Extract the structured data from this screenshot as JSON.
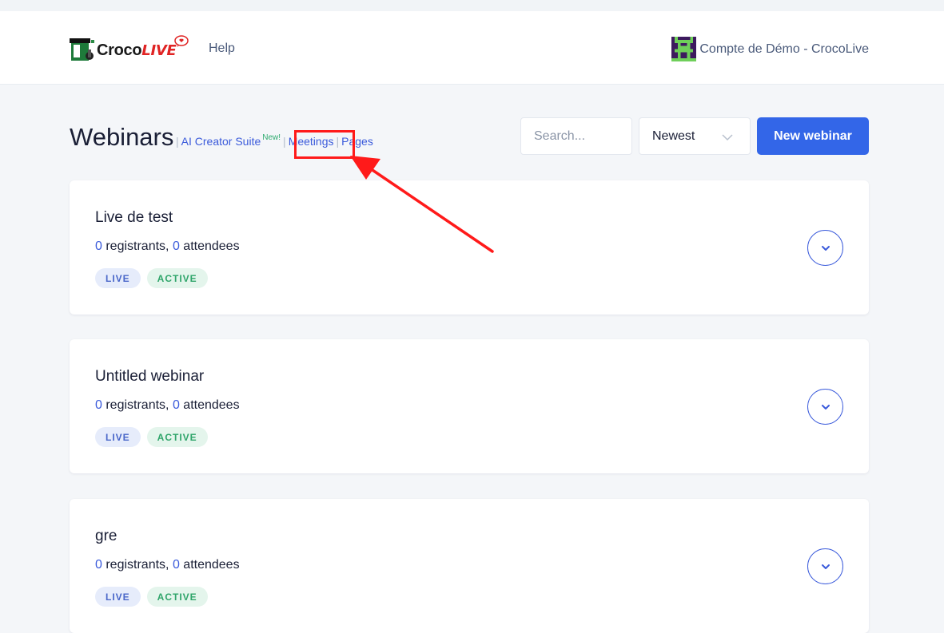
{
  "brand": {
    "word1": "Croco",
    "word2": "LIVE"
  },
  "header": {
    "help_label": "Help",
    "account_name": "Compte de Démo - CrocoLive"
  },
  "page": {
    "title": "Webinars",
    "subnav": [
      {
        "label": "AI Creator Suite",
        "badge": "New!"
      },
      {
        "label": "Meetings"
      },
      {
        "label": "Pages"
      }
    ]
  },
  "toolbar": {
    "search_placeholder": "Search...",
    "sort_value": "Newest",
    "new_button": "New webinar"
  },
  "webinars": [
    {
      "title": "Live de test",
      "registrants": "0",
      "registrants_label": " registrants, ",
      "attendees": "0",
      "attendees_label": " attendees",
      "badges": [
        "LIVE",
        "ACTIVE"
      ]
    },
    {
      "title": "Untitled webinar",
      "registrants": "0",
      "registrants_label": " registrants, ",
      "attendees": "0",
      "attendees_label": " attendees",
      "badges": [
        "LIVE",
        "ACTIVE"
      ]
    },
    {
      "title": "gre",
      "registrants": "0",
      "registrants_label": " registrants, ",
      "attendees": "0",
      "attendees_label": " attendees",
      "badges": [
        "LIVE",
        "ACTIVE"
      ]
    }
  ],
  "colors": {
    "primary": "#3366e8",
    "link": "#3b5bdb",
    "annotation": "#ff1a1a",
    "badge_live_bg": "#e6ecfb",
    "badge_active_bg": "#e4f5ec"
  }
}
